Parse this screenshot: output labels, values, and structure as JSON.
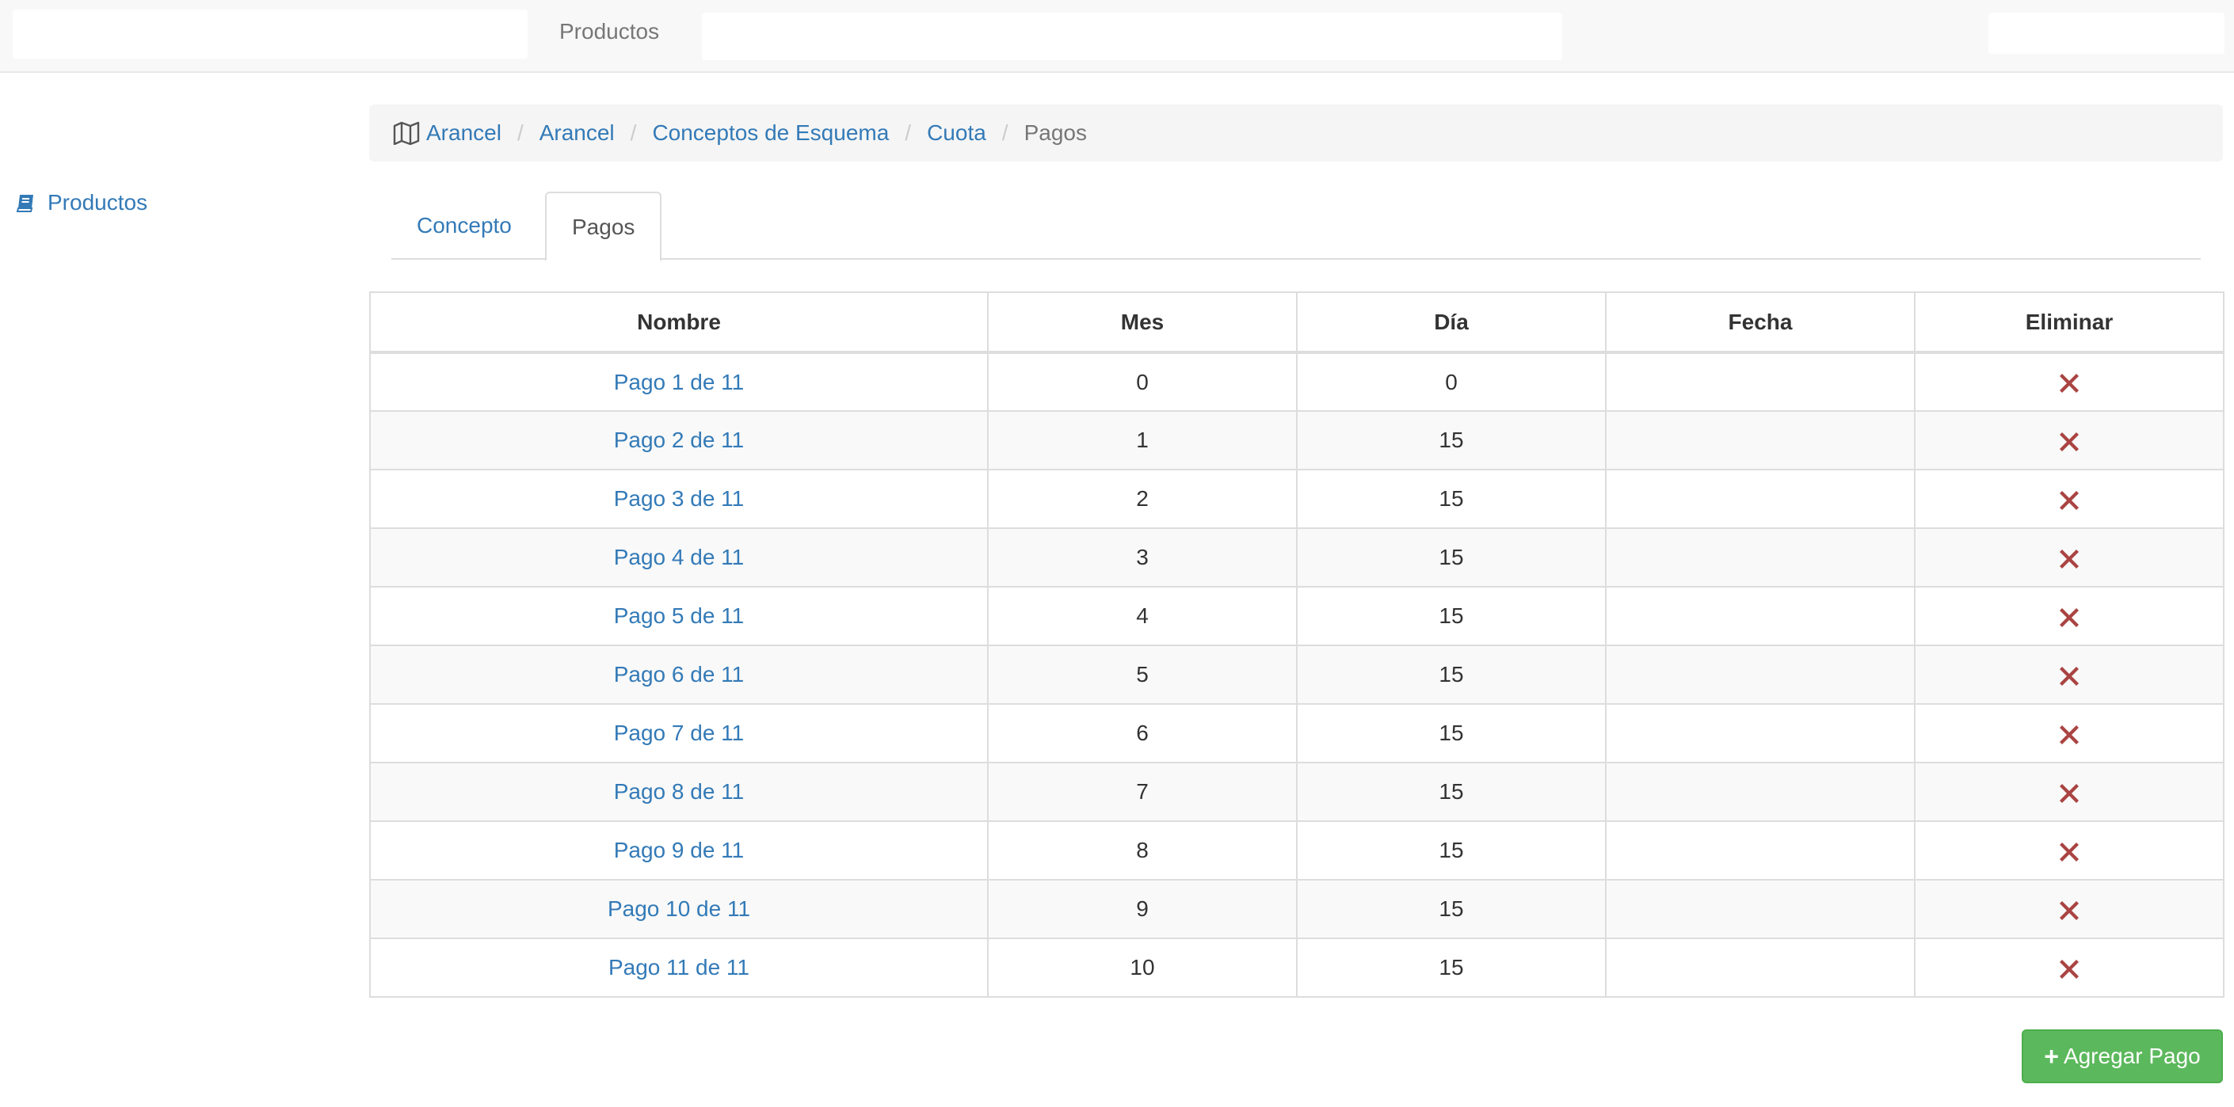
{
  "navbar": {
    "products_link": "Productos"
  },
  "sidebar": {
    "items": [
      {
        "label": "Productos",
        "icon": "book-icon"
      }
    ]
  },
  "breadcrumb": {
    "icon": "map-icon",
    "items": [
      "Arancel",
      "Arancel",
      "Conceptos de Esquema",
      "Cuota"
    ],
    "active": "Pagos",
    "separator": "/"
  },
  "tabs": [
    {
      "label": "Concepto",
      "active": false
    },
    {
      "label": "Pagos",
      "active": true
    }
  ],
  "table": {
    "headers": [
      "Nombre",
      "Mes",
      "Día",
      "Fecha",
      "Eliminar"
    ],
    "rows": [
      {
        "nombre": "Pago 1 de 11",
        "mes": "0",
        "dia": "0",
        "fecha": ""
      },
      {
        "nombre": "Pago 2 de 11",
        "mes": "1",
        "dia": "15",
        "fecha": ""
      },
      {
        "nombre": "Pago 3 de 11",
        "mes": "2",
        "dia": "15",
        "fecha": ""
      },
      {
        "nombre": "Pago 4 de 11",
        "mes": "3",
        "dia": "15",
        "fecha": ""
      },
      {
        "nombre": "Pago 5 de 11",
        "mes": "4",
        "dia": "15",
        "fecha": ""
      },
      {
        "nombre": "Pago 6 de 11",
        "mes": "5",
        "dia": "15",
        "fecha": ""
      },
      {
        "nombre": "Pago 7 de 11",
        "mes": "6",
        "dia": "15",
        "fecha": ""
      },
      {
        "nombre": "Pago 8 de 11",
        "mes": "7",
        "dia": "15",
        "fecha": ""
      },
      {
        "nombre": "Pago 9 de 11",
        "mes": "8",
        "dia": "15",
        "fecha": ""
      },
      {
        "nombre": "Pago 10 de 11",
        "mes": "9",
        "dia": "15",
        "fecha": ""
      },
      {
        "nombre": "Pago 11 de 11",
        "mes": "10",
        "dia": "15",
        "fecha": ""
      }
    ],
    "delete_icon": "close-icon"
  },
  "actions": {
    "add_label": "Agregar Pago",
    "add_icon": "plus-icon"
  },
  "colors": {
    "link": "#337ab7",
    "success": "#5cb85c",
    "danger": "#a94442"
  }
}
